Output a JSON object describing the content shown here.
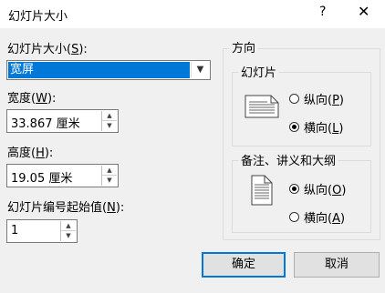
{
  "window": {
    "title": "幻灯片大小",
    "help_glyph": "?",
    "close_glyph": "✕"
  },
  "size": {
    "label_prefix": "幻灯片大小(",
    "label_key": "S",
    "label_suffix": "):",
    "selected": "宽屏"
  },
  "width": {
    "label_prefix": "宽度(",
    "label_key": "W",
    "label_suffix": "):",
    "value": "33.867 厘米"
  },
  "height": {
    "label_prefix": "高度(",
    "label_key": "H",
    "label_suffix": "):",
    "value": "19.05 厘米"
  },
  "numbering": {
    "label_prefix": "幻灯片编号起始值(",
    "label_key": "N",
    "label_suffix": "):",
    "value": "1"
  },
  "orientation": {
    "title": "方向",
    "slides": {
      "title": "幻灯片",
      "portrait_prefix": "纵向(",
      "portrait_key": "P",
      "portrait_suffix": ")",
      "landscape_prefix": "横向(",
      "landscape_key": "L",
      "landscape_suffix": ")",
      "selected": "landscape"
    },
    "notes": {
      "title": "备注、讲义和大纲",
      "portrait_prefix": "纵向(",
      "portrait_key": "O",
      "portrait_suffix": ")",
      "landscape_prefix": "横向(",
      "landscape_key": "A",
      "landscape_suffix": ")",
      "selected": "portrait"
    }
  },
  "buttons": {
    "ok": "确定",
    "cancel": "取消"
  },
  "colors": {
    "selection": "#0078d7",
    "background": "#f0f0f0"
  }
}
